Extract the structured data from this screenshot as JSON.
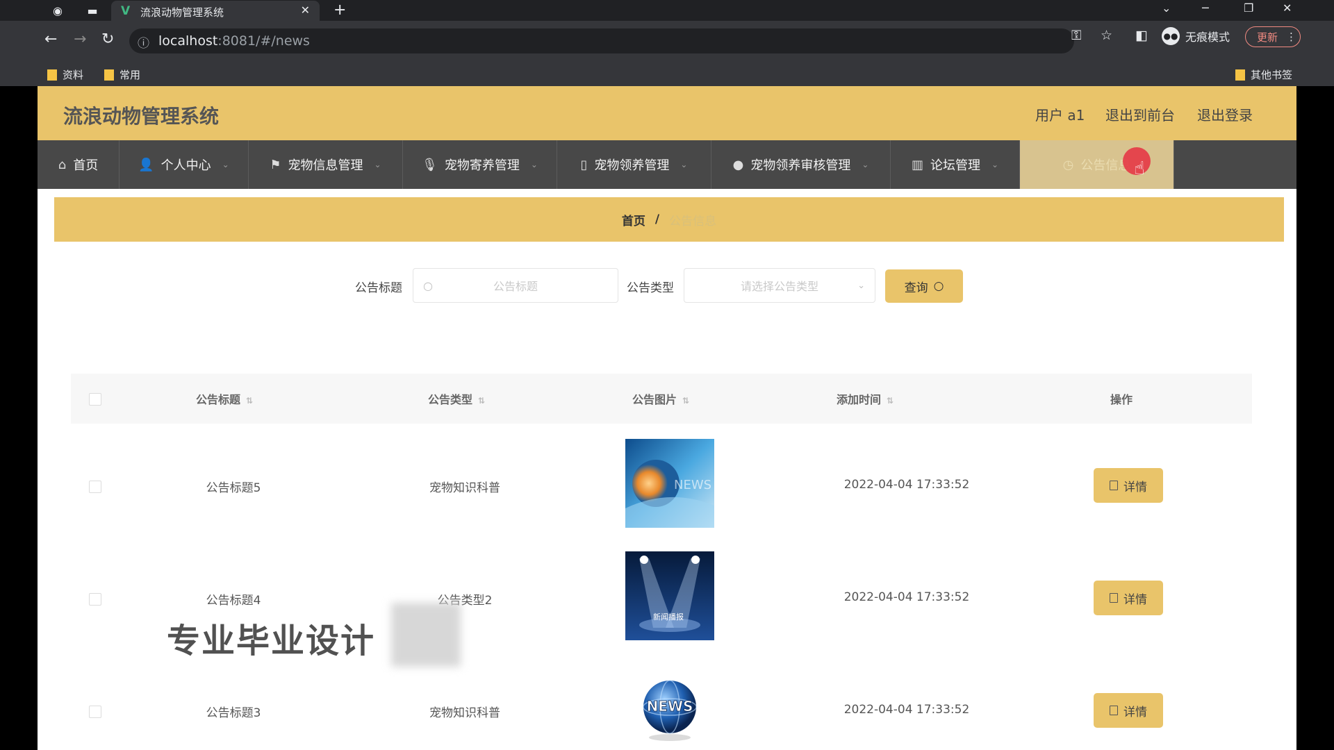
{
  "browser": {
    "tab_title": "流浪动物管理系统",
    "close_glyph": "✕",
    "new_tab_glyph": "+",
    "url_host": "localhost",
    "url_rest": ":8081/#/news",
    "incognito_label": "无痕模式",
    "update_label": "更新",
    "bookmarks": [
      "资料",
      "常用"
    ],
    "other_bookmarks": "其他书签"
  },
  "header": {
    "title": "流浪动物管理系统",
    "user": "用户 a1",
    "to_front": "退出到前台",
    "logout": "退出登录"
  },
  "menu": [
    {
      "label": "首页",
      "icon": "home-icon"
    },
    {
      "label": "个人中心",
      "icon": "user-icon"
    },
    {
      "label": "宠物信息管理",
      "icon": "flag-icon"
    },
    {
      "label": "宠物寄养管理",
      "icon": "mic-icon"
    },
    {
      "label": "宠物领养管理",
      "icon": "phone-icon"
    },
    {
      "label": "宠物领养审核管理",
      "icon": "chat-icon"
    },
    {
      "label": "论坛管理",
      "icon": "chart-icon"
    },
    {
      "label": "公告信息",
      "icon": "clock-icon"
    }
  ],
  "breadcrumb": {
    "home": "首页",
    "sep": "/",
    "current": "公告信息"
  },
  "search": {
    "title_label": "公告标题",
    "title_placeholder": "公告标题",
    "type_label": "公告类型",
    "type_placeholder": "请选择公告类型",
    "query_label": "查询"
  },
  "table": {
    "columns": [
      "公告标题",
      "公告类型",
      "公告图片",
      "添加时间",
      "操作"
    ],
    "rows": [
      {
        "title": "公告标题5",
        "type": "宠物知识科普",
        "time": "2022-04-04 17:33:52",
        "action": "详情"
      },
      {
        "title": "公告标题4",
        "type": "公告类型2",
        "time": "2022-04-04 17:33:52",
        "action": "详情"
      },
      {
        "title": "公告标题3",
        "type": "宠物知识科普",
        "time": "2022-04-04 17:33:52",
        "action": "详情"
      }
    ]
  },
  "thumb_text": {
    "news": "NEWS",
    "news2": "新闻播报"
  },
  "watermark": "专业毕业设计",
  "colors": {
    "accent": "#e9c46a",
    "menubar": "#484848",
    "active_menu": "#d8c38f"
  }
}
